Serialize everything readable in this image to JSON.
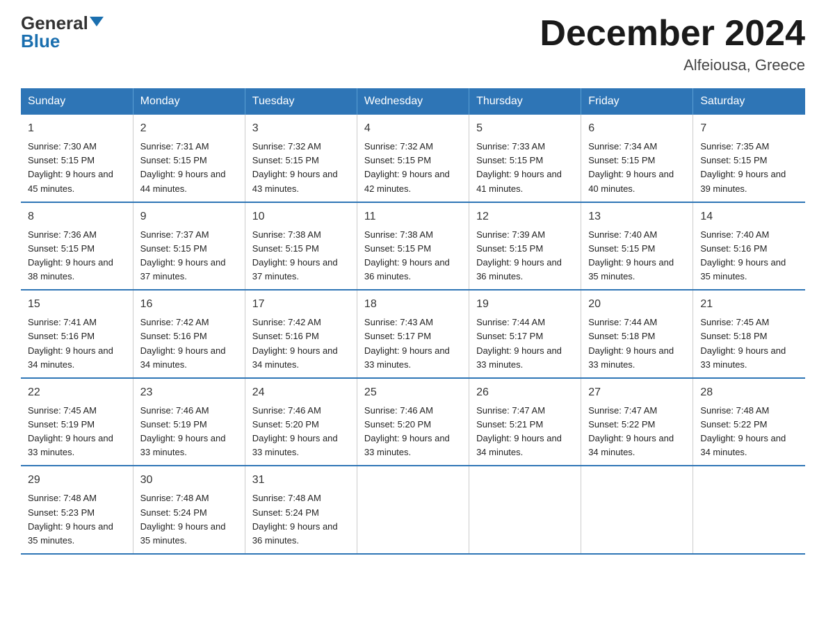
{
  "header": {
    "logo_general": "General",
    "logo_blue": "Blue",
    "month_title": "December 2024",
    "location": "Alfeiousa, Greece"
  },
  "days_of_week": [
    "Sunday",
    "Monday",
    "Tuesday",
    "Wednesday",
    "Thursday",
    "Friday",
    "Saturday"
  ],
  "weeks": [
    [
      {
        "day": "1",
        "sunrise": "7:30 AM",
        "sunset": "5:15 PM",
        "daylight": "9 hours and 45 minutes."
      },
      {
        "day": "2",
        "sunrise": "7:31 AM",
        "sunset": "5:15 PM",
        "daylight": "9 hours and 44 minutes."
      },
      {
        "day": "3",
        "sunrise": "7:32 AM",
        "sunset": "5:15 PM",
        "daylight": "9 hours and 43 minutes."
      },
      {
        "day": "4",
        "sunrise": "7:32 AM",
        "sunset": "5:15 PM",
        "daylight": "9 hours and 42 minutes."
      },
      {
        "day": "5",
        "sunrise": "7:33 AM",
        "sunset": "5:15 PM",
        "daylight": "9 hours and 41 minutes."
      },
      {
        "day": "6",
        "sunrise": "7:34 AM",
        "sunset": "5:15 PM",
        "daylight": "9 hours and 40 minutes."
      },
      {
        "day": "7",
        "sunrise": "7:35 AM",
        "sunset": "5:15 PM",
        "daylight": "9 hours and 39 minutes."
      }
    ],
    [
      {
        "day": "8",
        "sunrise": "7:36 AM",
        "sunset": "5:15 PM",
        "daylight": "9 hours and 38 minutes."
      },
      {
        "day": "9",
        "sunrise": "7:37 AM",
        "sunset": "5:15 PM",
        "daylight": "9 hours and 37 minutes."
      },
      {
        "day": "10",
        "sunrise": "7:38 AM",
        "sunset": "5:15 PM",
        "daylight": "9 hours and 37 minutes."
      },
      {
        "day": "11",
        "sunrise": "7:38 AM",
        "sunset": "5:15 PM",
        "daylight": "9 hours and 36 minutes."
      },
      {
        "day": "12",
        "sunrise": "7:39 AM",
        "sunset": "5:15 PM",
        "daylight": "9 hours and 36 minutes."
      },
      {
        "day": "13",
        "sunrise": "7:40 AM",
        "sunset": "5:15 PM",
        "daylight": "9 hours and 35 minutes."
      },
      {
        "day": "14",
        "sunrise": "7:40 AM",
        "sunset": "5:16 PM",
        "daylight": "9 hours and 35 minutes."
      }
    ],
    [
      {
        "day": "15",
        "sunrise": "7:41 AM",
        "sunset": "5:16 PM",
        "daylight": "9 hours and 34 minutes."
      },
      {
        "day": "16",
        "sunrise": "7:42 AM",
        "sunset": "5:16 PM",
        "daylight": "9 hours and 34 minutes."
      },
      {
        "day": "17",
        "sunrise": "7:42 AM",
        "sunset": "5:16 PM",
        "daylight": "9 hours and 34 minutes."
      },
      {
        "day": "18",
        "sunrise": "7:43 AM",
        "sunset": "5:17 PM",
        "daylight": "9 hours and 33 minutes."
      },
      {
        "day": "19",
        "sunrise": "7:44 AM",
        "sunset": "5:17 PM",
        "daylight": "9 hours and 33 minutes."
      },
      {
        "day": "20",
        "sunrise": "7:44 AM",
        "sunset": "5:18 PM",
        "daylight": "9 hours and 33 minutes."
      },
      {
        "day": "21",
        "sunrise": "7:45 AM",
        "sunset": "5:18 PM",
        "daylight": "9 hours and 33 minutes."
      }
    ],
    [
      {
        "day": "22",
        "sunrise": "7:45 AM",
        "sunset": "5:19 PM",
        "daylight": "9 hours and 33 minutes."
      },
      {
        "day": "23",
        "sunrise": "7:46 AM",
        "sunset": "5:19 PM",
        "daylight": "9 hours and 33 minutes."
      },
      {
        "day": "24",
        "sunrise": "7:46 AM",
        "sunset": "5:20 PM",
        "daylight": "9 hours and 33 minutes."
      },
      {
        "day": "25",
        "sunrise": "7:46 AM",
        "sunset": "5:20 PM",
        "daylight": "9 hours and 33 minutes."
      },
      {
        "day": "26",
        "sunrise": "7:47 AM",
        "sunset": "5:21 PM",
        "daylight": "9 hours and 34 minutes."
      },
      {
        "day": "27",
        "sunrise": "7:47 AM",
        "sunset": "5:22 PM",
        "daylight": "9 hours and 34 minutes."
      },
      {
        "day": "28",
        "sunrise": "7:48 AM",
        "sunset": "5:22 PM",
        "daylight": "9 hours and 34 minutes."
      }
    ],
    [
      {
        "day": "29",
        "sunrise": "7:48 AM",
        "sunset": "5:23 PM",
        "daylight": "9 hours and 35 minutes."
      },
      {
        "day": "30",
        "sunrise": "7:48 AM",
        "sunset": "5:24 PM",
        "daylight": "9 hours and 35 minutes."
      },
      {
        "day": "31",
        "sunrise": "7:48 AM",
        "sunset": "5:24 PM",
        "daylight": "9 hours and 36 minutes."
      },
      null,
      null,
      null,
      null
    ]
  ]
}
